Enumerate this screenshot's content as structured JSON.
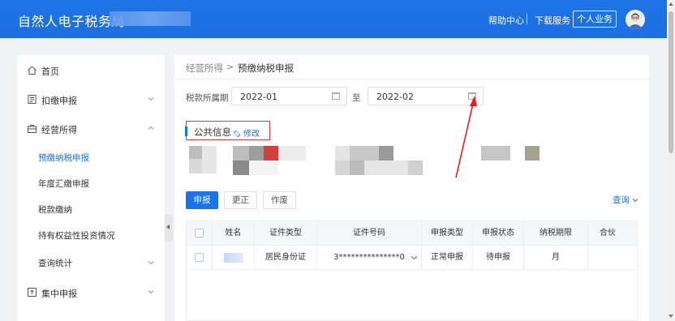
{
  "header": {
    "brand": "自然人电子税务局",
    "help": "帮助中心",
    "download": "下载服务",
    "personal": "个人业务"
  },
  "sidebar": {
    "home": "首页",
    "withhold": "扣缴申报",
    "business": "经营所得",
    "sub_items": [
      "预缴纳税申报",
      "年度汇缴申报",
      "税款缴纳",
      "持有权益性投资情况",
      "查询统计"
    ],
    "centralized": "集中申报"
  },
  "breadcrumb": {
    "parent": "经营所得",
    "separator": ">",
    "current": "预缴纳税申报"
  },
  "filters": {
    "period_label": "税款所属期",
    "start": "2022-01",
    "to": "至",
    "end": "2022-02"
  },
  "public_info": {
    "title": "公共信息",
    "edit": "修改"
  },
  "toolbar": {
    "declare": "申报",
    "correct": "更正",
    "void": "作废",
    "query": "查询"
  },
  "table": {
    "headers": [
      "姓名",
      "证件类型",
      "证件号码",
      "申报类型",
      "申报状态",
      "纳税期限",
      "合伙"
    ],
    "rows": [
      {
        "name": "",
        "id_type": "居民身份证",
        "id_number": "3***************0",
        "decl_type": "正常申报",
        "status": "待申报",
        "period": "月"
      }
    ]
  },
  "colors": {
    "primary": "#1a73e8",
    "highlight": "#e03b3b"
  }
}
